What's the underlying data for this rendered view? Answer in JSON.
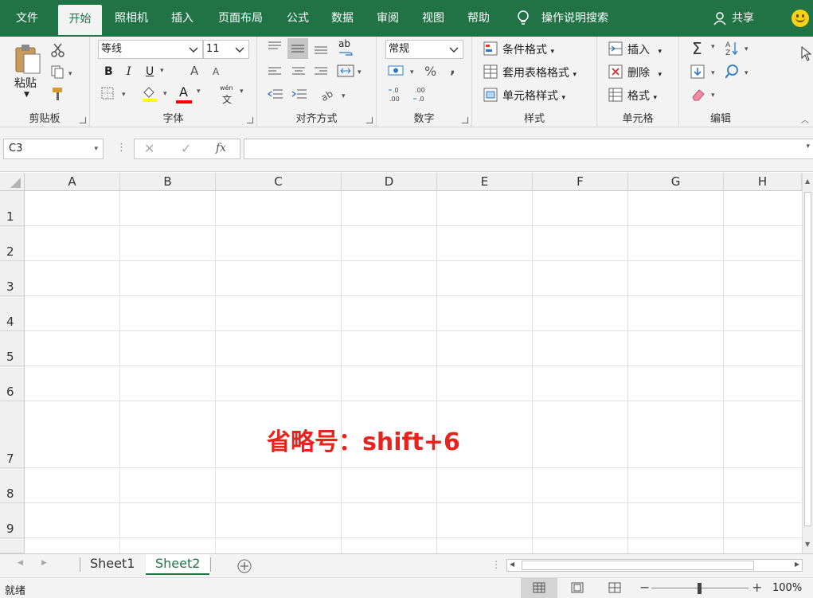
{
  "tabs": [
    {
      "label": "文件",
      "active": false
    },
    {
      "label": "开始",
      "active": true
    },
    {
      "label": "照相机",
      "active": false
    },
    {
      "label": "插入",
      "active": false
    },
    {
      "label": "页面布局",
      "active": false
    },
    {
      "label": "公式",
      "active": false
    },
    {
      "label": "数据",
      "active": false
    },
    {
      "label": "审阅",
      "active": false
    },
    {
      "label": "视图",
      "active": false
    },
    {
      "label": "帮助",
      "active": false
    }
  ],
  "tell_me": "操作说明搜索",
  "share": "共享",
  "ribbon": {
    "clipboard": {
      "paste": "粘贴",
      "label": "剪贴板"
    },
    "font": {
      "name": "等线",
      "size": "11",
      "bold": "B",
      "italic": "I",
      "underline": "U",
      "grow": "A",
      "shrink": "A",
      "font_color": "A",
      "phonetic_top": "wén",
      "phonetic_bottom": "文",
      "label": "字体"
    },
    "alignment": {
      "label": "对齐方式",
      "wrap": "ab"
    },
    "number": {
      "format": "常规",
      "percent": "%",
      "comma": ",",
      "inc_decimal": "←.0\n.00",
      "label": "数字"
    },
    "styles": {
      "conditional": "条件格式",
      "table": "套用表格格式",
      "cell": "单元格样式",
      "label": "样式"
    },
    "cells": {
      "insert": "插入",
      "delete": "删除",
      "format": "格式",
      "label": "单元格"
    },
    "editing": {
      "sum": "Σ",
      "sort": "A↓Z",
      "label": "编辑"
    }
  },
  "formula_bar": {
    "name_box": "C3",
    "cancel": "✕",
    "enter": "✓",
    "fx": "fx",
    "value": ""
  },
  "columns": [
    "A",
    "B",
    "C",
    "D",
    "E",
    "F",
    "G",
    "H"
  ],
  "rows": [
    "1",
    "2",
    "3",
    "4",
    "5",
    "6",
    "7",
    "8",
    "9"
  ],
  "overlay_text": "省略号：shift+6",
  "sheets": [
    {
      "name": "Sheet1",
      "active": false
    },
    {
      "name": "Sheet2",
      "active": true
    }
  ],
  "status": {
    "ready": "就绪",
    "zoom": "100%"
  },
  "colors": {
    "accent": "#217346",
    "overlay": "#e8231e",
    "highlight": "#ffff00",
    "font_red": "#ff0000"
  }
}
